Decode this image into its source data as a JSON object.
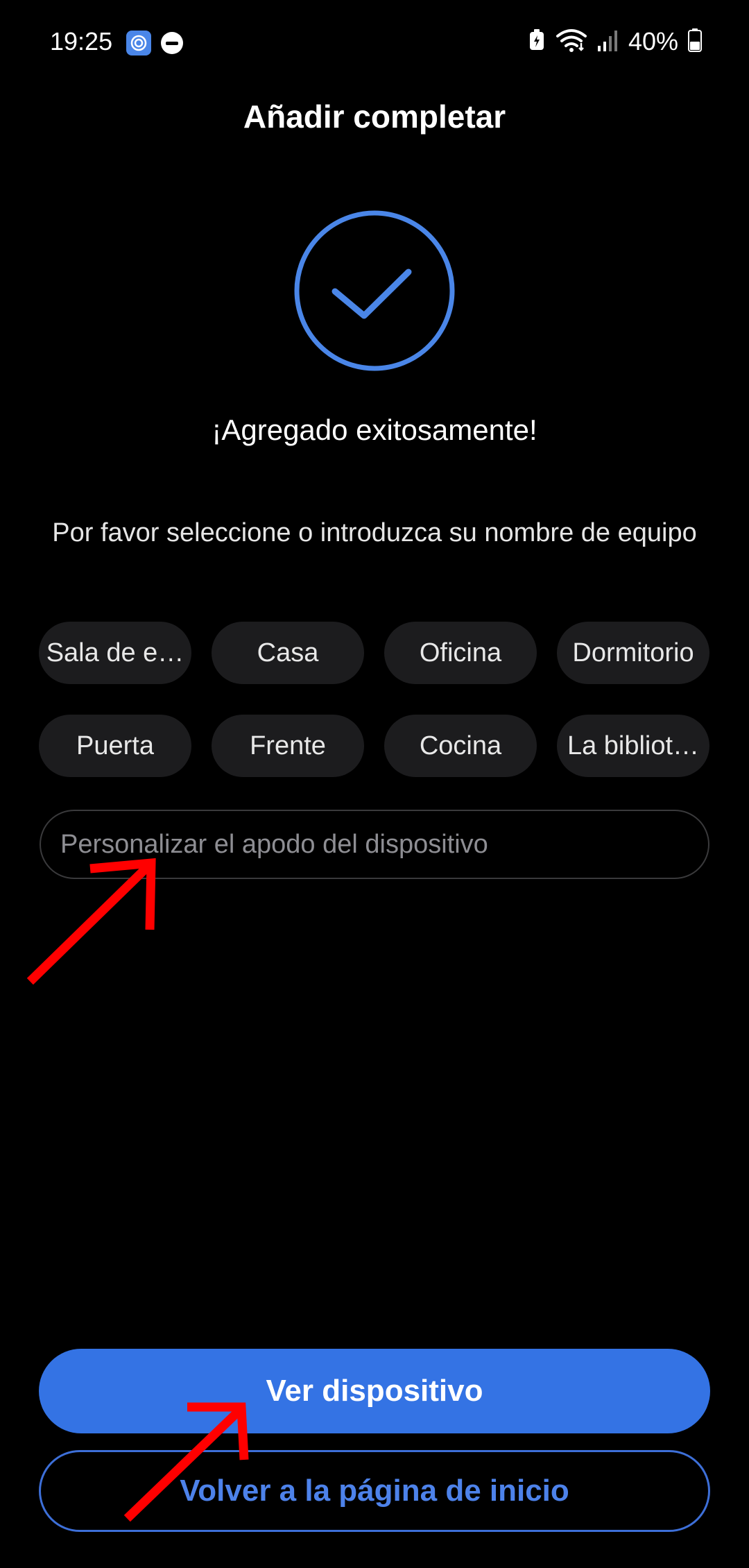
{
  "status_bar": {
    "time": "19:25",
    "battery_percent": "40%",
    "icons": [
      "app-notification-icon",
      "do-not-disturb-icon",
      "battery-saver-icon",
      "wifi-icon",
      "signal-icon",
      "battery-icon"
    ]
  },
  "header": {
    "title": "Añadir completar"
  },
  "success": {
    "icon": "checkmark-circle-icon",
    "message": "¡Agregado exitosamente!",
    "instruction": "Por favor seleccione o introduzca su nombre de equipo"
  },
  "chips": [
    {
      "label": "Sala de e…"
    },
    {
      "label": "Casa"
    },
    {
      "label": "Oficina"
    },
    {
      "label": "Dormitorio"
    },
    {
      "label": "Puerta"
    },
    {
      "label": "Frente"
    },
    {
      "label": "Cocina"
    },
    {
      "label": "La bibliot…"
    }
  ],
  "nickname": {
    "value": "",
    "placeholder": "Personalizar el apodo del dispositivo"
  },
  "buttons": {
    "primary_label": "Ver dispositivo",
    "secondary_label": "Volver a la página de inicio"
  },
  "colors": {
    "accent": "#3473e4",
    "check_ring": "#4a86e8",
    "annotation": "#ff0000",
    "background": "#000000"
  }
}
